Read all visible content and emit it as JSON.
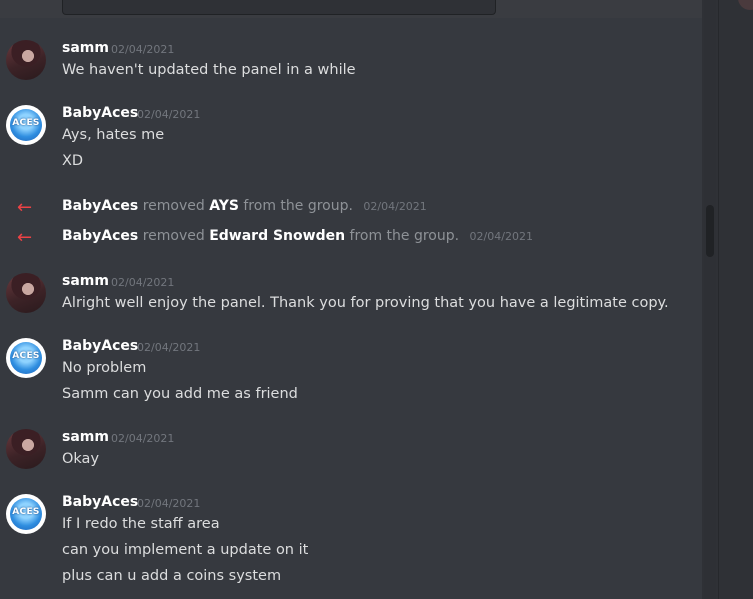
{
  "messages": [
    {
      "author": "samm",
      "timestamp": "02/04/2021",
      "lines": [
        "We haven't updated the panel in a while"
      ]
    },
    {
      "author": "BabyAces",
      "timestamp": "02/04/2021",
      "lines": [
        "Ays, hates me",
        "XD"
      ]
    },
    {
      "author": "samm",
      "timestamp": "02/04/2021",
      "lines": [
        "Alright well enjoy the panel. Thank you for proving that you have a legitimate copy."
      ]
    },
    {
      "author": "BabyAces",
      "timestamp": "02/04/2021",
      "lines": [
        "No problem",
        "Samm can you add me as friend"
      ]
    },
    {
      "author": "samm",
      "timestamp": "02/04/2021",
      "lines": [
        "Okay"
      ]
    },
    {
      "author": "BabyAces",
      "timestamp": "02/04/2021",
      "lines": [
        "If I redo the staff area",
        "can you implement a update on it",
        "plus can u add a coins system"
      ]
    }
  ],
  "system_events": [
    {
      "actor": "BabyAces",
      "verb": "removed",
      "target": "AYS",
      "suffix": "from the group.",
      "timestamp": "02/04/2021"
    },
    {
      "actor": "BabyAces",
      "verb": "removed",
      "target": "Edward Snowden",
      "suffix": "from the group.",
      "timestamp": "02/04/2021"
    }
  ],
  "avatar_text": "ACES",
  "icons": {
    "system_event": "left-arrow-icon"
  },
  "colors": {
    "background": "#36393f",
    "username": "#ffffff",
    "text": "#dcddde",
    "timestamp": "#72767d",
    "remove_arrow": "#ed4245"
  }
}
